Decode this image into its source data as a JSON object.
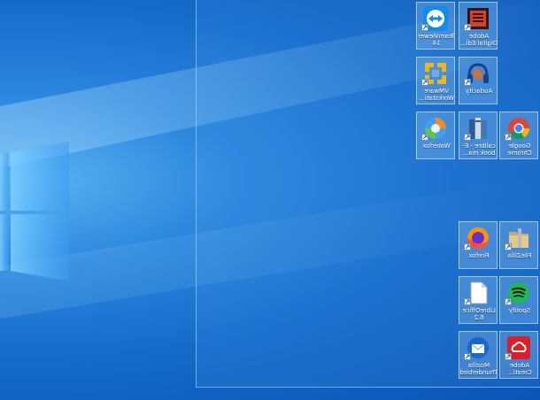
{
  "desktop": {
    "icons": [
      {
        "label": "TeamViewer 14",
        "icon": "teamviewer-icon"
      },
      {
        "label": "Adobe Digital Edi...",
        "icon": "adobe-digital-editions-icon"
      },
      {
        "label": "VMware Workstati...",
        "icon": "vmware-icon"
      },
      {
        "label": "Audacity",
        "icon": "audacity-icon"
      },
      {
        "label": "Waterfox",
        "icon": "waterfox-icon"
      },
      {
        "label": "calibre - E-book ma...",
        "icon": "calibre-icon"
      },
      {
        "label": "Google Chrome",
        "icon": "chrome-icon"
      },
      {
        "label": "Firefox",
        "icon": "firefox-icon"
      },
      {
        "label": "FileZilla",
        "icon": "filezilla-icon"
      },
      {
        "label": "LibreOffice 6.2",
        "icon": "libreoffice-icon"
      },
      {
        "label": "Spotify",
        "icon": "spotify-icon"
      },
      {
        "label": "Mozilla Thunderbird",
        "icon": "thunderbird-icon"
      },
      {
        "label": "Adobe Creati...",
        "icon": "creative-cloud-icon"
      }
    ]
  },
  "colors": {
    "wallpaper_dark": "#0b55b5",
    "wallpaper_light": "#5ab4f2",
    "selection_fill": "#9fd2ff"
  }
}
